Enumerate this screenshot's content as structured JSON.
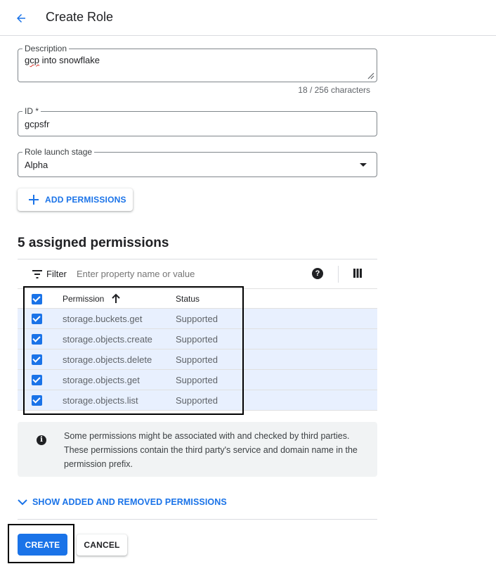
{
  "header": {
    "back_icon": "arrow-back-icon",
    "title": "Create Role"
  },
  "form": {
    "description": {
      "label": "Description",
      "value_misspelled": "gcp",
      "value_rest": " into snowflake",
      "char_count": "18 / 256 characters"
    },
    "id": {
      "label": "ID *",
      "value": "gcpsfr"
    },
    "launch_stage": {
      "label": "Role launch stage",
      "value": "Alpha"
    }
  },
  "add_permissions_label": "ADD PERMISSIONS",
  "permissions": {
    "title": "5 assigned permissions",
    "filter_label": "Filter",
    "filter_placeholder": "Enter property name or value",
    "columns": {
      "permission": "Permission",
      "status": "Status"
    },
    "rows": [
      {
        "permission": "storage.buckets.get",
        "status": "Supported"
      },
      {
        "permission": "storage.objects.create",
        "status": "Supported"
      },
      {
        "permission": "storage.objects.delete",
        "status": "Supported"
      },
      {
        "permission": "storage.objects.get",
        "status": "Supported"
      },
      {
        "permission": "storage.objects.list",
        "status": "Supported"
      }
    ]
  },
  "info": {
    "text": "Some permissions might be associated with and checked by third parties. These permissions contain the third party's service and domain name in the permission prefix."
  },
  "show_changes_label": "SHOW ADDED AND REMOVED PERMISSIONS",
  "actions": {
    "create": "CREATE",
    "cancel": "CANCEL"
  },
  "colors": {
    "accent": "#1a73e8",
    "row_selected": "#e8f0fe",
    "annotation_box": "#000000"
  }
}
